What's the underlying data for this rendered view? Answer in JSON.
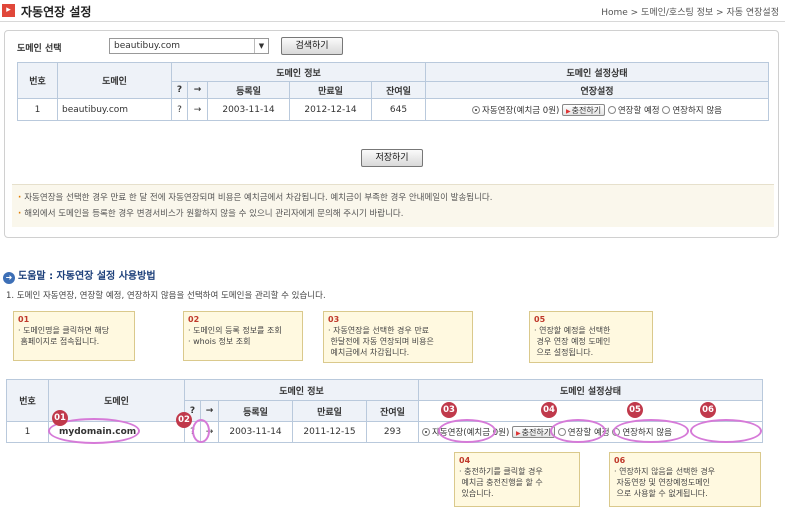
{
  "header": {
    "title": "자동연장 설정",
    "breadcrumb": "Home > 도메인/호스팅 정보 > 자동 연장설정"
  },
  "selector": {
    "label": "도메인 선택",
    "value": "beautibuy.com",
    "search_button": "검색하기"
  },
  "table": {
    "headers": {
      "no": "번호",
      "domain": "도메인",
      "info": "도메인 정보",
      "status": "도메인 설정상태",
      "q": "?",
      "arrow": "→",
      "reg": "등록일",
      "exp": "만료일",
      "left": "잔여일",
      "ext": "연장설정"
    },
    "row": {
      "no": "1",
      "domain": "beautibuy.com",
      "q": "?",
      "arrow": "→",
      "reg": "2003-11-14",
      "exp": "2012-12-14",
      "left": "645",
      "opt1": "자동연장(예치금 0원)",
      "charge": "충전하기",
      "opt2": "연장할 예정",
      "opt3": "연장하지 않음"
    }
  },
  "save_button": "저장하기",
  "notes": [
    "자동연장을 선택한 경우 만료 한 달 전에 자동연장되며 비용은 예치금에서 차감됩니다. 예치금이 부족한 경우 안내메일이 발송됩니다.",
    "해외에서 도메인을 등록한 경우 변경서비스가 원활하지 않을 수 있으니 관리자에게 문의해 주시기 바랍니다."
  ],
  "help": {
    "title": "도움말 : 자동연장 설정 사용방법",
    "desc": "1. 도메인 자동연장, 연장할 예정, 연장하지 않음을 선택하여 도메인을 관리할 수 있습니다.",
    "tips": {
      "t01": {
        "n": "01",
        "text": "· 도메인명을 클릭하면 해당\n 홈페이지로 접속됩니다."
      },
      "t02": {
        "n": "02",
        "text": "· 도메인의 등록 정보를 조회\n· whois 정보 조회"
      },
      "t03": {
        "n": "03",
        "text": "· 자동연장을 선택한 경우 만료\n 한달전에 자동 연장되며 비용은\n 예치금에서 차감됩니다."
      },
      "t04": {
        "n": "04",
        "text": "· 충전하기를 클릭할 경우\n 예치금 충전진행을 할 수\n 있습니다."
      },
      "t05": {
        "n": "05",
        "text": "· 연장할 예정을 선택한\n 경우 연장 예정 도메인\n 으로 설정됩니다."
      },
      "t06": {
        "n": "06",
        "text": "· 연장하지 않음을 선택한 경우\n 자동연장 및 연장예정도메인\n 으로 사용할 수 없게됩니다."
      }
    },
    "example": {
      "no": "1",
      "domain": "mydomain.com",
      "q": "?",
      "arrow": "→",
      "reg": "2003-11-14",
      "exp": "2011-12-15",
      "left": "293",
      "opt1": "자동연장(예치금 0원)",
      "charge": "충전하기",
      "opt2": "연장할 예정",
      "opt3": "연장하지 않음"
    },
    "markers": [
      "01",
      "02",
      "03",
      "04",
      "05",
      "06"
    ]
  }
}
